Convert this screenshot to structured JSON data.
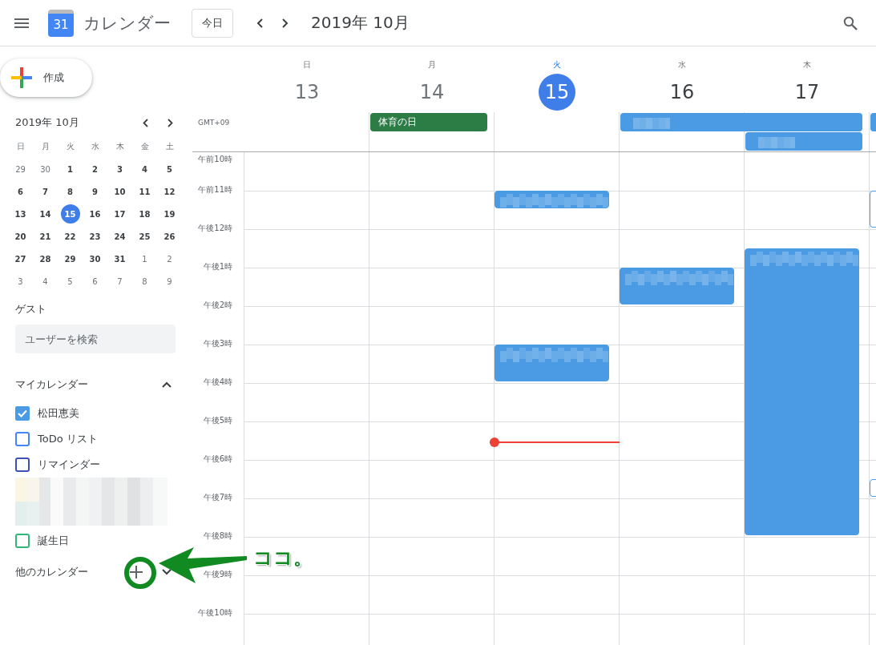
{
  "app_bar": {
    "title": "カレンダー",
    "logo_text": "31",
    "today_button": "今日",
    "period": "2019年 10月"
  },
  "create_button": "作成",
  "mini_calendar": {
    "title": "2019年 10月",
    "weekdays": [
      "日",
      "月",
      "火",
      "水",
      "木",
      "金",
      "土"
    ],
    "days": [
      {
        "text": "29",
        "outside": true,
        "selected": false
      },
      {
        "text": "30",
        "outside": true,
        "selected": false
      },
      {
        "text": "1",
        "outside": false,
        "selected": false
      },
      {
        "text": "2",
        "outside": false,
        "selected": false
      },
      {
        "text": "3",
        "outside": false,
        "selected": false
      },
      {
        "text": "4",
        "outside": false,
        "selected": false
      },
      {
        "text": "5",
        "outside": false,
        "selected": false
      },
      {
        "text": "6",
        "outside": false,
        "selected": false
      },
      {
        "text": "7",
        "outside": false,
        "selected": false
      },
      {
        "text": "8",
        "outside": false,
        "selected": false
      },
      {
        "text": "9",
        "outside": false,
        "selected": false
      },
      {
        "text": "10",
        "outside": false,
        "selected": false
      },
      {
        "text": "11",
        "outside": false,
        "selected": false
      },
      {
        "text": "12",
        "outside": false,
        "selected": false
      },
      {
        "text": "13",
        "outside": false,
        "selected": false
      },
      {
        "text": "14",
        "outside": false,
        "selected": false
      },
      {
        "text": "15",
        "outside": false,
        "selected": true
      },
      {
        "text": "16",
        "outside": false,
        "selected": false
      },
      {
        "text": "17",
        "outside": false,
        "selected": false
      },
      {
        "text": "18",
        "outside": false,
        "selected": false
      },
      {
        "text": "19",
        "outside": false,
        "selected": false
      },
      {
        "text": "20",
        "outside": false,
        "selected": false
      },
      {
        "text": "21",
        "outside": false,
        "selected": false
      },
      {
        "text": "22",
        "outside": false,
        "selected": false
      },
      {
        "text": "23",
        "outside": false,
        "selected": false
      },
      {
        "text": "24",
        "outside": false,
        "selected": false
      },
      {
        "text": "25",
        "outside": false,
        "selected": false
      },
      {
        "text": "26",
        "outside": false,
        "selected": false
      },
      {
        "text": "27",
        "outside": false,
        "selected": false
      },
      {
        "text": "28",
        "outside": false,
        "selected": false
      },
      {
        "text": "29",
        "outside": false,
        "selected": false
      },
      {
        "text": "30",
        "outside": false,
        "selected": false
      },
      {
        "text": "31",
        "outside": false,
        "selected": false
      },
      {
        "text": "1",
        "outside": true,
        "selected": false
      },
      {
        "text": "2",
        "outside": true,
        "selected": false
      },
      {
        "text": "3",
        "outside": true,
        "selected": false
      },
      {
        "text": "4",
        "outside": true,
        "selected": false
      },
      {
        "text": "5",
        "outside": true,
        "selected": false
      },
      {
        "text": "6",
        "outside": true,
        "selected": false
      },
      {
        "text": "7",
        "outside": true,
        "selected": false
      },
      {
        "text": "8",
        "outside": true,
        "selected": false
      },
      {
        "text": "9",
        "outside": true,
        "selected": false
      }
    ]
  },
  "guests": {
    "heading": "ゲスト",
    "placeholder": "ユーザーを検索"
  },
  "my_calendars": {
    "heading": "マイカレンダー",
    "expanded": true,
    "items": [
      {
        "kind": "checkbox",
        "label": "松田恵美",
        "checked": true,
        "color": "#4a9be4"
      },
      {
        "kind": "checkbox",
        "label": "ToDo リスト",
        "checked": false,
        "color": "#4285f4"
      },
      {
        "kind": "checkbox",
        "label": "リマインダー",
        "checked": false,
        "color": "#3f51b5"
      },
      {
        "kind": "blurred"
      },
      {
        "kind": "checkbox",
        "label": "誕生日",
        "checked": false,
        "color": "#33b679"
      }
    ]
  },
  "other_calendars": {
    "heading": "他のカレンダー",
    "expanded": false
  },
  "timezone": "GMT+09",
  "days": [
    {
      "weekday": "日",
      "date": "13",
      "selected": false,
      "past": true
    },
    {
      "weekday": "月",
      "date": "14",
      "selected": false,
      "past": true,
      "all_day": [
        {
          "kind": "single",
          "title": "体育の日",
          "color": "#2b7d45"
        }
      ]
    },
    {
      "weekday": "火",
      "date": "15",
      "selected": true,
      "past": false,
      "current_time": true,
      "events": [
        {
          "kind": "filled",
          "color": "#4a9be4"
        },
        {
          "kind": "filled",
          "color": "#4a9be4"
        }
      ]
    },
    {
      "weekday": "水",
      "date": "16",
      "selected": false,
      "past": false,
      "all_day": [
        {
          "kind": "multi",
          "color": "#4a9be4"
        }
      ],
      "events": [
        {
          "kind": "filled",
          "color": "#4a9be4"
        }
      ]
    },
    {
      "weekday": "木",
      "date": "17",
      "selected": false,
      "past": false,
      "all_day": [
        {
          "kind": "single",
          "color": "#4a9be4"
        }
      ],
      "events": [
        {
          "kind": "filled",
          "color": "#4a9be4"
        }
      ]
    },
    {
      "all_day": [
        {
          "kind": "single",
          "color": "#4a9be4"
        }
      ],
      "events": [
        {
          "kind": "outlined",
          "color": "#4a9be4"
        },
        {
          "kind": "outlined",
          "color": "#4a9be4"
        }
      ]
    }
  ],
  "hours": [
    "午前10時",
    "午前11時",
    "午後12時",
    "午後1時",
    "午後2時",
    "午後3時",
    "午後4時",
    "午後5時",
    "午後6時",
    "午後7時",
    "午後8時",
    "午後9時",
    "午後10時"
  ],
  "annotation": {
    "text": "ココ。"
  }
}
